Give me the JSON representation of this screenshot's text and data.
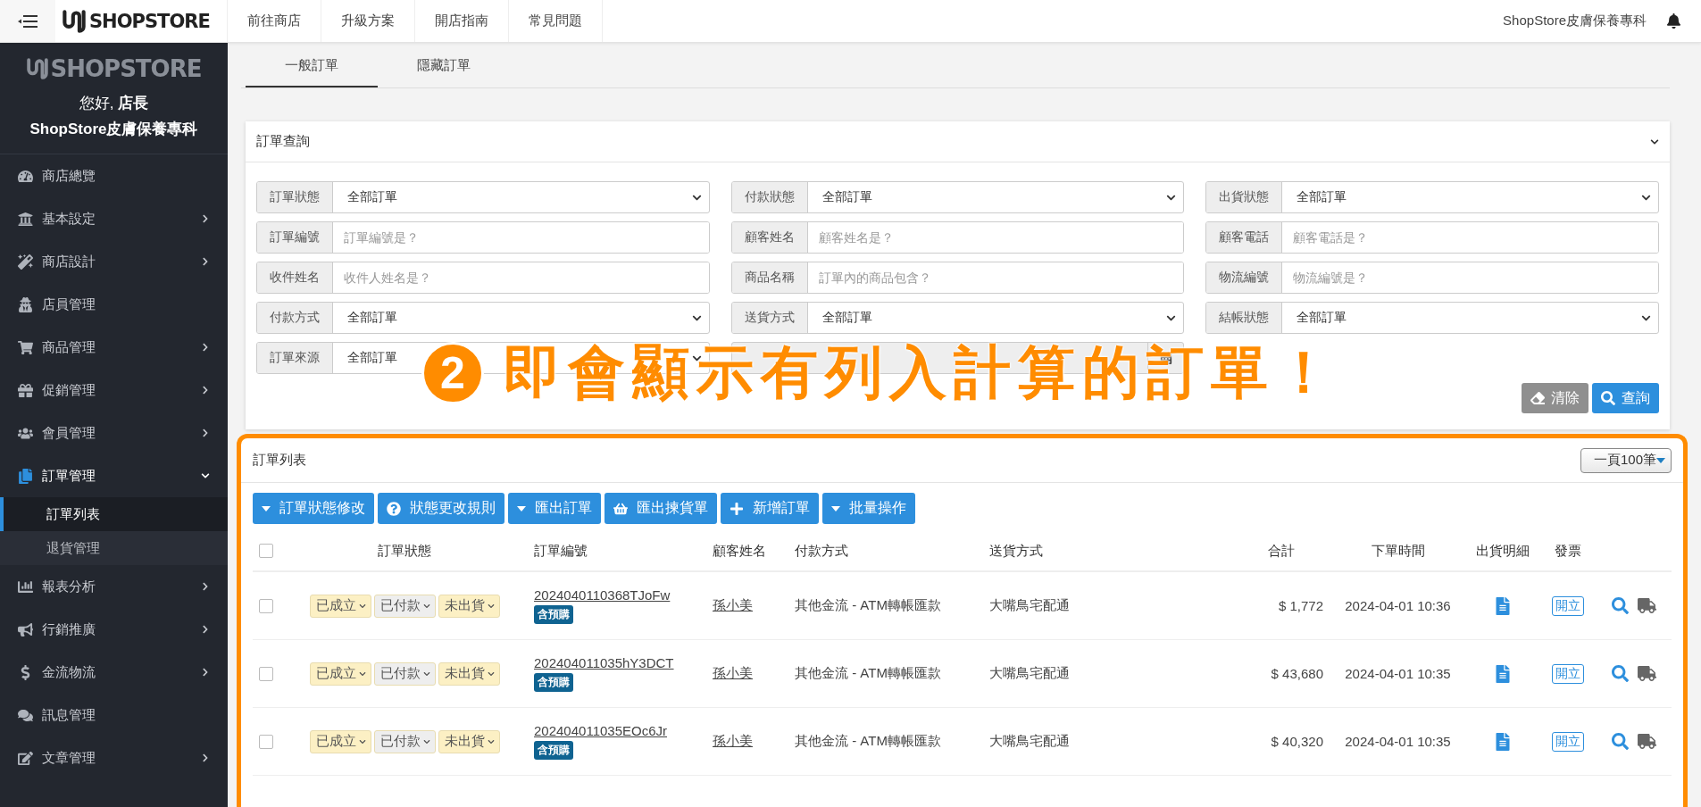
{
  "topbar": {
    "brand": "SHOPSTORE",
    "links": [
      "前往商店",
      "升級方案",
      "開店指南",
      "常見問題"
    ],
    "store_name": "ShopStore皮膚保養專科"
  },
  "sidebar": {
    "brand": "SHOPSTORE",
    "greeting": "您好, **店長**",
    "store_name": "ShopStore皮膚保養專科",
    "items": [
      {
        "label": "商店總覽",
        "expandable": false,
        "expanded": false
      },
      {
        "label": "基本設定",
        "expandable": true,
        "expanded": false
      },
      {
        "label": "商店設計",
        "expandable": true,
        "expanded": false
      },
      {
        "label": "店員管理",
        "expandable": false,
        "expanded": false
      },
      {
        "label": "商品管理",
        "expandable": true,
        "expanded": false
      },
      {
        "label": "促銷管理",
        "expandable": true,
        "expanded": false
      },
      {
        "label": "會員管理",
        "expandable": true,
        "expanded": false
      },
      {
        "label": "訂單管理",
        "expandable": true,
        "expanded": true,
        "children": [
          {
            "label": "訂單列表",
            "selected": true
          },
          {
            "label": "退貨管理",
            "selected": false
          }
        ]
      },
      {
        "label": "報表分析",
        "expandable": true,
        "expanded": false
      },
      {
        "label": "行銷推廣",
        "expandable": true,
        "expanded": false
      },
      {
        "label": "金流物流",
        "expandable": true,
        "expanded": false
      },
      {
        "label": "訊息管理",
        "expandable": false,
        "expanded": false
      },
      {
        "label": "文章管理",
        "expandable": true,
        "expanded": false
      }
    ]
  },
  "tabs": [
    {
      "label": "一般訂單",
      "selected": true
    },
    {
      "label": "隱藏訂單",
      "selected": false
    }
  ],
  "filter": {
    "title": "訂單查詢",
    "expanded": true,
    "fields": [
      {
        "label": "訂單狀態",
        "kind": "select",
        "value": "全部訂單"
      },
      {
        "label": "付款狀態",
        "kind": "select",
        "value": "全部訂單"
      },
      {
        "label": "出貨狀態",
        "kind": "select",
        "value": "全部訂單"
      },
      {
        "label": "訂單編號",
        "kind": "text",
        "placeholder": "訂單編號是？"
      },
      {
        "label": "顧客姓名",
        "kind": "text",
        "placeholder": "顧客姓名是？"
      },
      {
        "label": "顧客電話",
        "kind": "text",
        "placeholder": "顧客電話是？"
      },
      {
        "label": "收件姓名",
        "kind": "text",
        "placeholder": "收件人姓名是？"
      },
      {
        "label": "商品名稱",
        "kind": "text",
        "placeholder": "訂單內的商品包含？"
      },
      {
        "label": "物流編號",
        "kind": "text",
        "placeholder": "物流編號是？"
      },
      {
        "label": "付款方式",
        "kind": "select",
        "value": "全部訂單"
      },
      {
        "label": "送貨方式",
        "kind": "select",
        "value": "全部訂單"
      },
      {
        "label": "結帳狀態",
        "kind": "select",
        "value": "全部訂單"
      },
      {
        "label": "訂單來源",
        "kind": "select",
        "value": "全部訂單"
      },
      {
        "kind": "date"
      }
    ],
    "buttons": [
      {
        "label": "清除",
        "kind": "clear",
        "disabled": true
      },
      {
        "label": "查詢",
        "kind": "search",
        "disabled": false
      }
    ]
  },
  "annotation": {
    "number": "2",
    "text": "即會顯示有列入計算的訂單！"
  },
  "order_list": {
    "title": "訂單列表",
    "page_size": "一頁100筆",
    "select_all_checked": false,
    "actions": [
      {
        "label": "訂單狀態修改",
        "kind": "dropdown"
      },
      {
        "label": "狀態更改規則",
        "kind": "help"
      },
      {
        "label": "匯出訂單",
        "kind": "dropdown"
      },
      {
        "label": "匯出揀貨單",
        "kind": "basket"
      },
      {
        "label": "新增訂單",
        "kind": "add"
      },
      {
        "label": "批量操作",
        "kind": "dropdown"
      }
    ],
    "columns": [
      "訂單狀態",
      "訂單編號",
      "顧客姓名",
      "付款方式",
      "送貨方式",
      "合計",
      "下單時間",
      "出貨明細",
      "發票"
    ],
    "rows": [
      {
        "checked": false,
        "statuses": [
          {
            "label": "已成立",
            "color": "#fcf0c4"
          },
          {
            "label": "已付款",
            "color": "#eeeeee"
          },
          {
            "label": "未出貨",
            "color": "#fcf0c4"
          }
        ],
        "order_no": "2024040110368TJoFw",
        "badge": "含預購",
        "customer": "孫小美",
        "payment": "其他金流 - ATM轉帳匯款",
        "shipping": "大嘴鳥宅配通",
        "total": "$ 1,772",
        "time": "2024-04-01 10:36",
        "invoice": "開立"
      },
      {
        "checked": false,
        "statuses": [
          {
            "label": "已成立",
            "color": "#fcf0c4"
          },
          {
            "label": "已付款",
            "color": "#eeeeee"
          },
          {
            "label": "未出貨",
            "color": "#fcf0c4"
          }
        ],
        "order_no": "202404011035hY3DCT",
        "badge": "含預購",
        "customer": "孫小美",
        "payment": "其他金流 - ATM轉帳匯款",
        "shipping": "大嘴鳥宅配通",
        "total": "$ 43,680",
        "time": "2024-04-01 10:35",
        "invoice": "開立"
      },
      {
        "checked": false,
        "statuses": [
          {
            "label": "已成立",
            "color": "#fcf0c4"
          },
          {
            "label": "已付款",
            "color": "#eeeeee"
          },
          {
            "label": "未出貨",
            "color": "#fcf0c4"
          }
        ],
        "order_no": "202404011035EOc6Jr",
        "badge": "含預購",
        "customer": "孫小美",
        "payment": "其他金流 - ATM轉帳匯款",
        "shipping": "大嘴鳥宅配通",
        "total": "$ 40,320",
        "time": "2024-04-01 10:35",
        "invoice": "開立"
      }
    ]
  }
}
